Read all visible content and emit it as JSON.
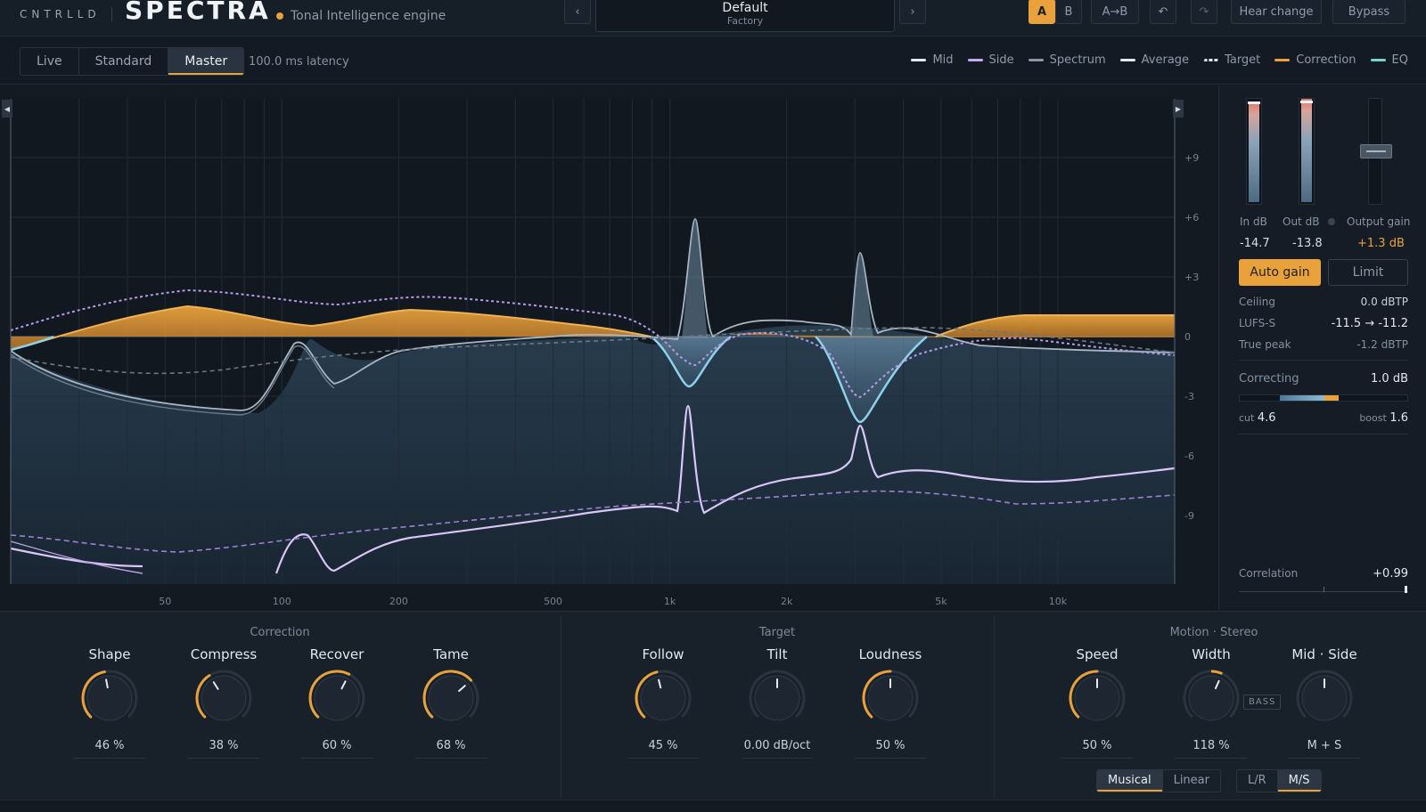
{
  "header": {
    "brand": "CNTRLLD",
    "product": "SPECTRA",
    "engine": "Tonal Intelligence engine",
    "preset_prev": "‹",
    "preset_next": "›",
    "preset_name": "Default",
    "preset_bank": "Factory",
    "ab_a": "A",
    "ab_b": "B",
    "ab_copy": "A→B",
    "undo": "↶",
    "redo": "↷",
    "hear_change": "Hear change",
    "bypass": "Bypass",
    "accent": "#e9a23b"
  },
  "toolbar": {
    "modes": [
      "Live",
      "Standard",
      "Master"
    ],
    "active_mode": "Master",
    "latency": "100.0 ms latency",
    "legend": [
      {
        "label": "Mid",
        "color": "#e6ebf0"
      },
      {
        "label": "Side",
        "color": "#c8a8f0"
      },
      {
        "label": "Spectrum",
        "color": "#8b97a5"
      },
      {
        "label": "Average",
        "color": "#e6ebf0"
      },
      {
        "label": "Target",
        "color": "#e6ebf0"
      },
      {
        "label": "Correction",
        "color": "#e9a23b"
      },
      {
        "label": "EQ",
        "color": "#6fd6c8"
      }
    ]
  },
  "graph": {
    "db_ticks": [
      "+9",
      "+6",
      "+3",
      "0",
      "-3",
      "-6",
      "-9"
    ],
    "freq_ticks": [
      "50",
      "100",
      "200",
      "500",
      "1k",
      "2k",
      "5k",
      "10k"
    ]
  },
  "meters": {
    "in_label": "In dB",
    "out_label": "Out dB",
    "gain_label": "Output gain",
    "in_value": "-14.7",
    "out_value": "-13.8",
    "gain_value": "+1.3 dB",
    "auto_gain": "Auto gain",
    "limit": "Limit",
    "ceiling_label": "Ceiling",
    "ceiling_value": "0.0 dBTP",
    "lufs_label": "LUFS-S",
    "lufs_value": "-11.5 → -11.2",
    "truepeak_label": "True peak",
    "truepeak_value": "-1.2 dBTP",
    "correcting_label": "Correcting",
    "correcting_value": "1.0 dB",
    "cut_label": "cut",
    "cut_value": "4.6",
    "boost_label": "boost",
    "boost_value": "1.6",
    "correlation_label": "Correlation",
    "correlation_value": "+0.99"
  },
  "sections": {
    "correction": "Correction",
    "target": "Target",
    "motion": "Motion · Stereo"
  },
  "knobs": [
    {
      "label": "Shape",
      "value": "46 %",
      "amount": 0.46
    },
    {
      "label": "Compress",
      "value": "38 %",
      "amount": 0.38
    },
    {
      "label": "Recover",
      "value": "60 %",
      "amount": 0.6
    },
    {
      "label": "Tame",
      "value": "68 %",
      "amount": 0.68
    },
    {
      "label": "Follow",
      "value": "45 %",
      "amount": 0.45
    },
    {
      "label": "Tilt",
      "value": "0.00 dB/oct",
      "amount": 0.5,
      "bipolar": true
    },
    {
      "label": "Loudness",
      "value": "50 %",
      "amount": 0.5
    },
    {
      "label": "Speed",
      "value": "50 %",
      "amount": 0.5
    },
    {
      "label": "Width",
      "value": "118 %",
      "amount": 0.59,
      "bipolar": true
    },
    {
      "label": "Mid · Side",
      "value": "M + S",
      "amount": 0.5,
      "bipolar": true
    }
  ],
  "bass_tag": "BASS",
  "curve_modes": [
    "Musical",
    "Linear"
  ],
  "stereo_modes": [
    "L/R",
    "M/S"
  ]
}
